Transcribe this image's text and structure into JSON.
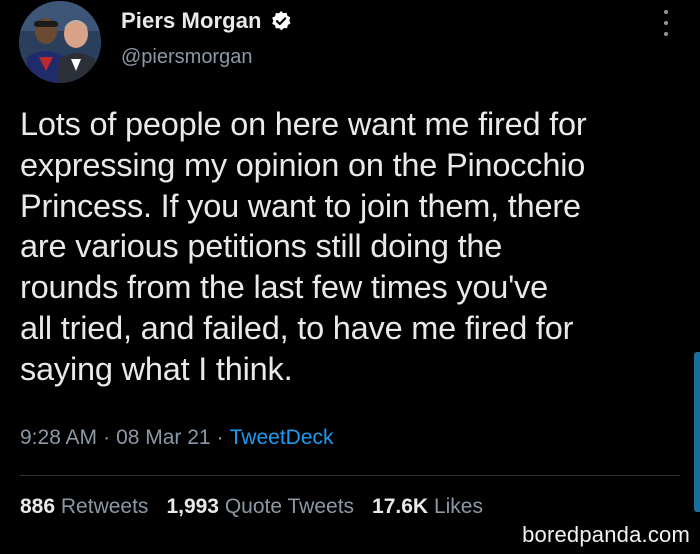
{
  "author": {
    "display_name": "Piers Morgan",
    "handle": "@piersmorgan",
    "verified": true
  },
  "tweet": {
    "text": "Lots of people on here want me fired for\nexpressing my opinion on the Pinocchio\nPrincess. If you want to join them, there\nare various petitions still doing the\nrounds from the last few times you've\nall tried, and failed, to have me fired for\nsaying what I think.",
    "time": "9:28 AM",
    "separator": "·",
    "date": "08 Mar 21",
    "source": "TweetDeck"
  },
  "stats": {
    "retweets_count": "886",
    "retweets_label": "Retweets",
    "quotes_count": "1,993",
    "quotes_label": "Quote Tweets",
    "likes_count": "17.6K",
    "likes_label": "Likes"
  },
  "watermark": "boredpanda.com",
  "colors": {
    "background": "#000000",
    "text_primary": "#e7e9ea",
    "text_secondary": "#8b98a5",
    "link": "#1d9bf0",
    "verified": "#ffffff",
    "divider": "#2f3336"
  },
  "icons": {
    "verified": "verified-badge-icon",
    "more": "more-vertical-icon"
  }
}
